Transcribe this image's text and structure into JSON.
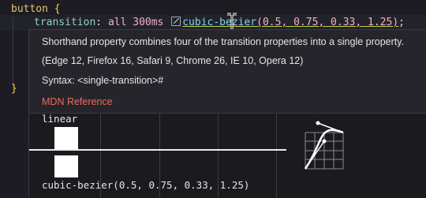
{
  "code": {
    "selector": "button",
    "open_brace": "{",
    "property": "transition",
    "colon": ":",
    "value_kw": "all",
    "duration": "300ms",
    "function_name": "cubic-bezier",
    "function_args": "(0.5, 0.75, 0.33, 1.25)",
    "semicolon": ";",
    "close_brace": "}"
  },
  "hover": {
    "description": "Shorthand property combines four of the transition properties into a single property.",
    "browsers": "(Edge 12, Firefox 16, Safari 9, Chrome 26, IE 10, Opera 12)",
    "syntax": "Syntax: <single-transition>#",
    "reference_link": "MDN Reference"
  },
  "preview": {
    "top_label": "linear",
    "bottom_label": "cubic-bezier(0.5, 0.75, 0.33, 1.25)",
    "bezier": [
      0.5,
      0.75,
      0.33,
      1.25
    ]
  },
  "colors": {
    "background": "#1c1c22",
    "popup": "#25252b",
    "link": "#f06a5a"
  }
}
